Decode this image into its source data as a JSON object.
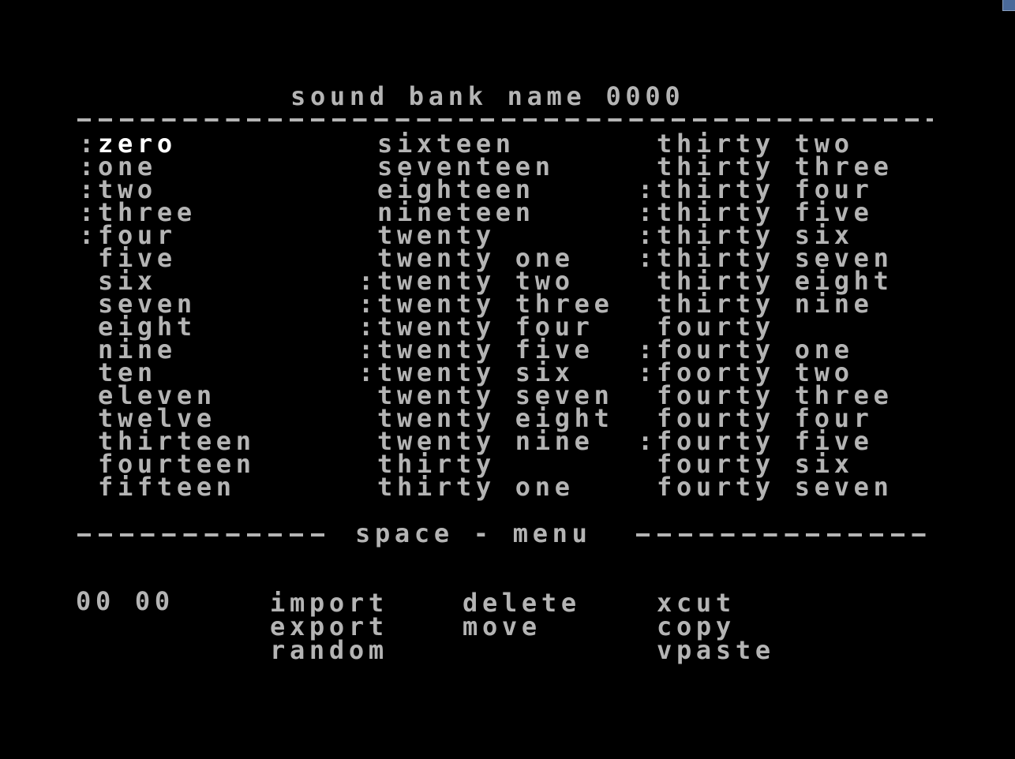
{
  "title": "sound bank name 0000",
  "sounds_col1": [
    {
      "marker": ":",
      "label": "zero",
      "selected": true
    },
    {
      "marker": ":",
      "label": "one"
    },
    {
      "marker": ":",
      "label": "two"
    },
    {
      "marker": ":",
      "label": "three"
    },
    {
      "marker": ":",
      "label": "four"
    },
    {
      "marker": "",
      "label": "five"
    },
    {
      "marker": "",
      "label": "six"
    },
    {
      "marker": "",
      "label": "seven"
    },
    {
      "marker": "",
      "label": "eight"
    },
    {
      "marker": "",
      "label": "nine"
    },
    {
      "marker": "",
      "label": "ten"
    },
    {
      "marker": "",
      "label": "eleven"
    },
    {
      "marker": "",
      "label": "twelve"
    },
    {
      "marker": "",
      "label": "thirteen"
    },
    {
      "marker": "",
      "label": "fourteen"
    },
    {
      "marker": "",
      "label": "fifteen"
    }
  ],
  "sounds_col2": [
    {
      "marker": "",
      "label": "sixteen"
    },
    {
      "marker": "",
      "label": "seventeen"
    },
    {
      "marker": "",
      "label": "eighteen"
    },
    {
      "marker": "",
      "label": "nineteen"
    },
    {
      "marker": "",
      "label": "twenty"
    },
    {
      "marker": "",
      "label": "twenty one"
    },
    {
      "marker": ":",
      "label": "twenty two"
    },
    {
      "marker": ":",
      "label": "twenty three"
    },
    {
      "marker": ":",
      "label": "twenty four"
    },
    {
      "marker": ":",
      "label": "twenty five"
    },
    {
      "marker": ":",
      "label": "twenty six"
    },
    {
      "marker": "",
      "label": "twenty seven"
    },
    {
      "marker": "",
      "label": "twenty eight"
    },
    {
      "marker": "",
      "label": "twenty nine"
    },
    {
      "marker": "",
      "label": "thirty"
    },
    {
      "marker": "",
      "label": "thirty one"
    }
  ],
  "sounds_col3": [
    {
      "marker": "",
      "label": "thirty two"
    },
    {
      "marker": "",
      "label": "thirty three"
    },
    {
      "marker": ":",
      "label": "thirty four"
    },
    {
      "marker": ":",
      "label": "thirty five"
    },
    {
      "marker": ":",
      "label": "thirty six"
    },
    {
      "marker": ":",
      "label": "thirty seven"
    },
    {
      "marker": "",
      "label": "thirty eight"
    },
    {
      "marker": "",
      "label": "thirty nine"
    },
    {
      "marker": "",
      "label": "fourty"
    },
    {
      "marker": ":",
      "label": "fourty one"
    },
    {
      "marker": ":",
      "label": "foorty two"
    },
    {
      "marker": "",
      "label": "fourty three"
    },
    {
      "marker": "",
      "label": "fourty four"
    },
    {
      "marker": ":",
      "label": "fourty five"
    },
    {
      "marker": "",
      "label": "fourty six"
    },
    {
      "marker": "",
      "label": "fourty seven"
    }
  ],
  "menu_hint": "space - menu",
  "counter": "00 00",
  "menu": {
    "import": "import",
    "export": "export",
    "random": "random",
    "delete": "delete",
    "move": "move",
    "xcut": "xcut",
    "copy": "copy",
    "vpaste": "vpaste"
  },
  "colors": {
    "background": "#000000",
    "text": "#b4b4b4",
    "selected_text": "#ffffff"
  }
}
